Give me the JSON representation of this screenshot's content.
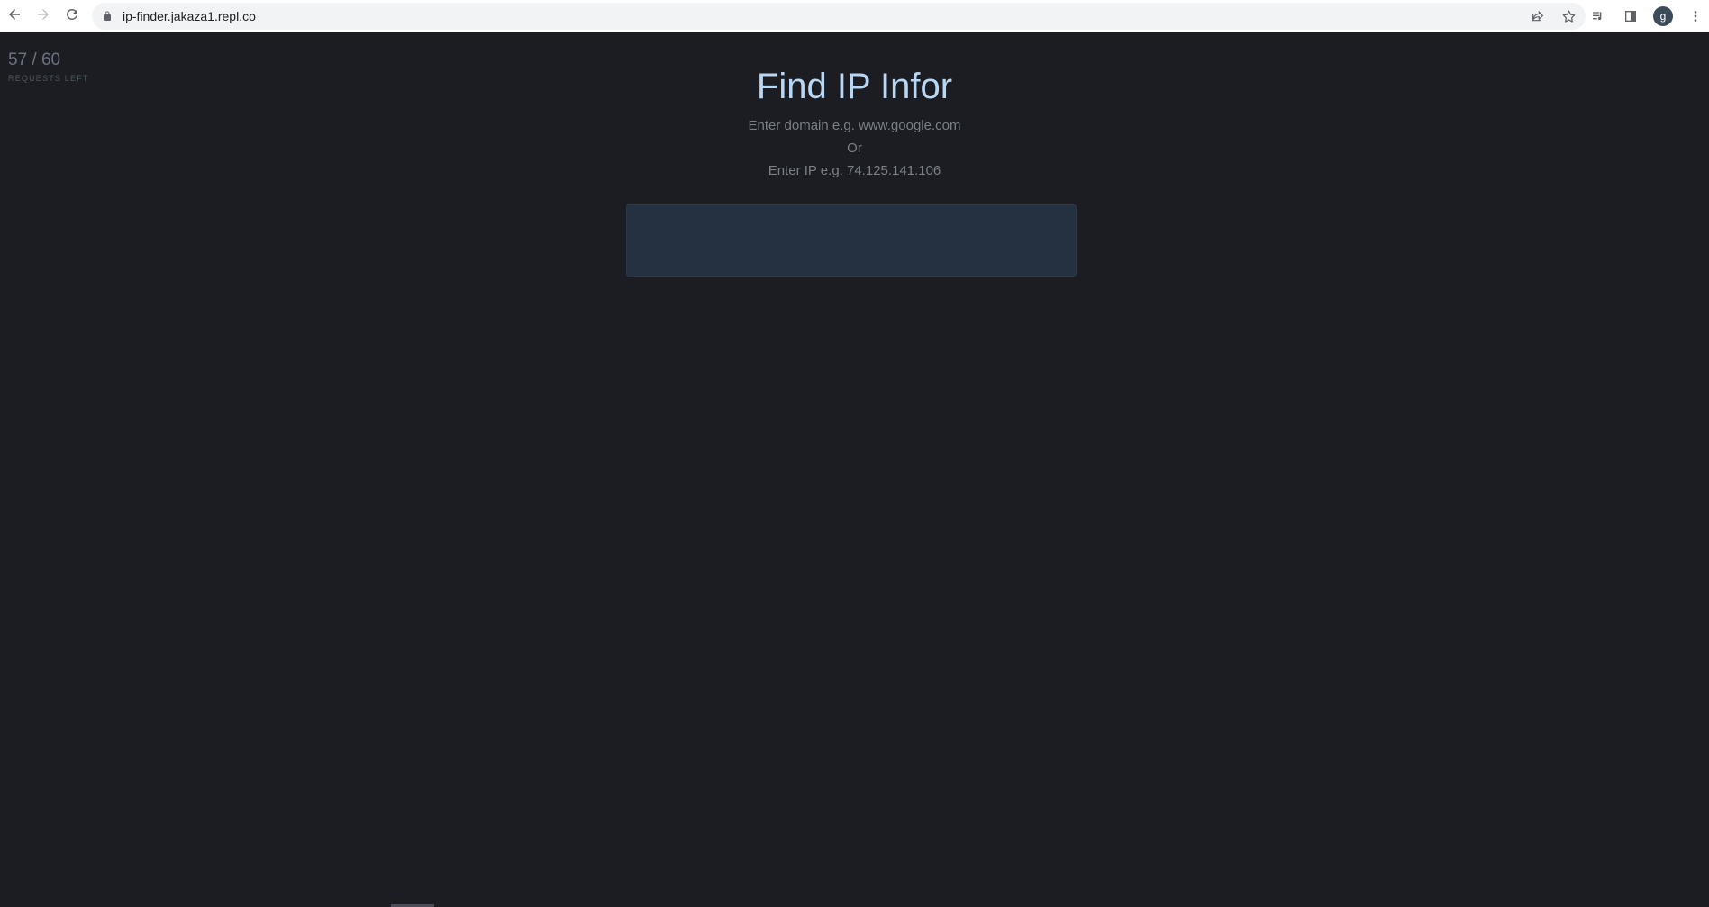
{
  "browser": {
    "url": "ip-finder.jakaza1.repl.co",
    "profile_initial": "g",
    "icons": {
      "back": "arrow-left-icon",
      "forward": "arrow-right-icon",
      "reload": "reload-icon",
      "lock": "lock-icon",
      "share": "share-icon",
      "bookmark": "star-icon",
      "media": "media-control-icon",
      "side_panel": "side-panel-icon",
      "menu": "kebab-menu-icon"
    }
  },
  "usage": {
    "count": "57 / 60",
    "label": "REQUESTS LEFT"
  },
  "header": {
    "title": "Find IP Infor",
    "hint_domain": "Enter domain e.g. www.google.com",
    "hint_or": "Or",
    "hint_ip": "Enter IP e.g. 74.125.141.106"
  },
  "search": {
    "value": "",
    "placeholder": ""
  },
  "colors": {
    "background": "#1b1d22",
    "title": "#b9d6f2",
    "input_bg": "#253040",
    "muted_text": "#7b8088"
  }
}
